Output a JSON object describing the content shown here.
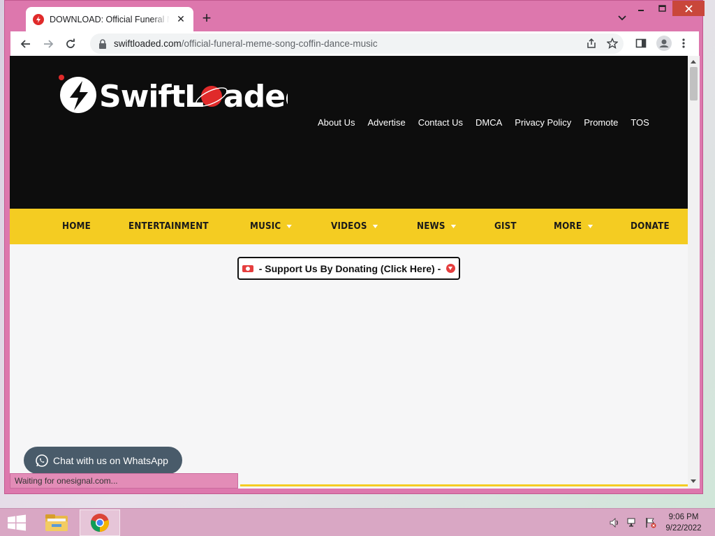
{
  "browser": {
    "tab_title": "DOWNLOAD: Official Funeral Meme Song",
    "tab_close": "✕",
    "new_tab": "+",
    "url_host": "swiftloaded.com",
    "url_path": "/official-funeral-meme-song-coffin-dance-music"
  },
  "site": {
    "logo_text": "SwiftLoaded",
    "top_nav": [
      "About Us",
      "Advertise",
      "Contact Us",
      "DMCA",
      "Privacy Policy",
      "Promote",
      "TOS"
    ],
    "main_nav": [
      {
        "label": "HOME",
        "dropdown": false
      },
      {
        "label": "ENTERTAINMENT",
        "dropdown": false
      },
      {
        "label": "MUSIC",
        "dropdown": true
      },
      {
        "label": "VIDEOS",
        "dropdown": true
      },
      {
        "label": "NEWS",
        "dropdown": true
      },
      {
        "label": "GIST",
        "dropdown": false
      },
      {
        "label": "MORE",
        "dropdown": true
      },
      {
        "label": "DONATE",
        "dropdown": false
      }
    ],
    "donate_text": "- Support Us By Donating (Click Here) -",
    "whatsapp_text": "Chat with us on WhatsApp"
  },
  "status_bar": "Waiting for onesignal.com...",
  "taskbar": {
    "time": "9:06 PM",
    "date": "9/22/2022"
  },
  "colors": {
    "window_frame": "#dd77ad",
    "header_bg": "#0d0d0d",
    "nav_bg": "#f4cc22",
    "accent_red": "#e53e3e"
  }
}
